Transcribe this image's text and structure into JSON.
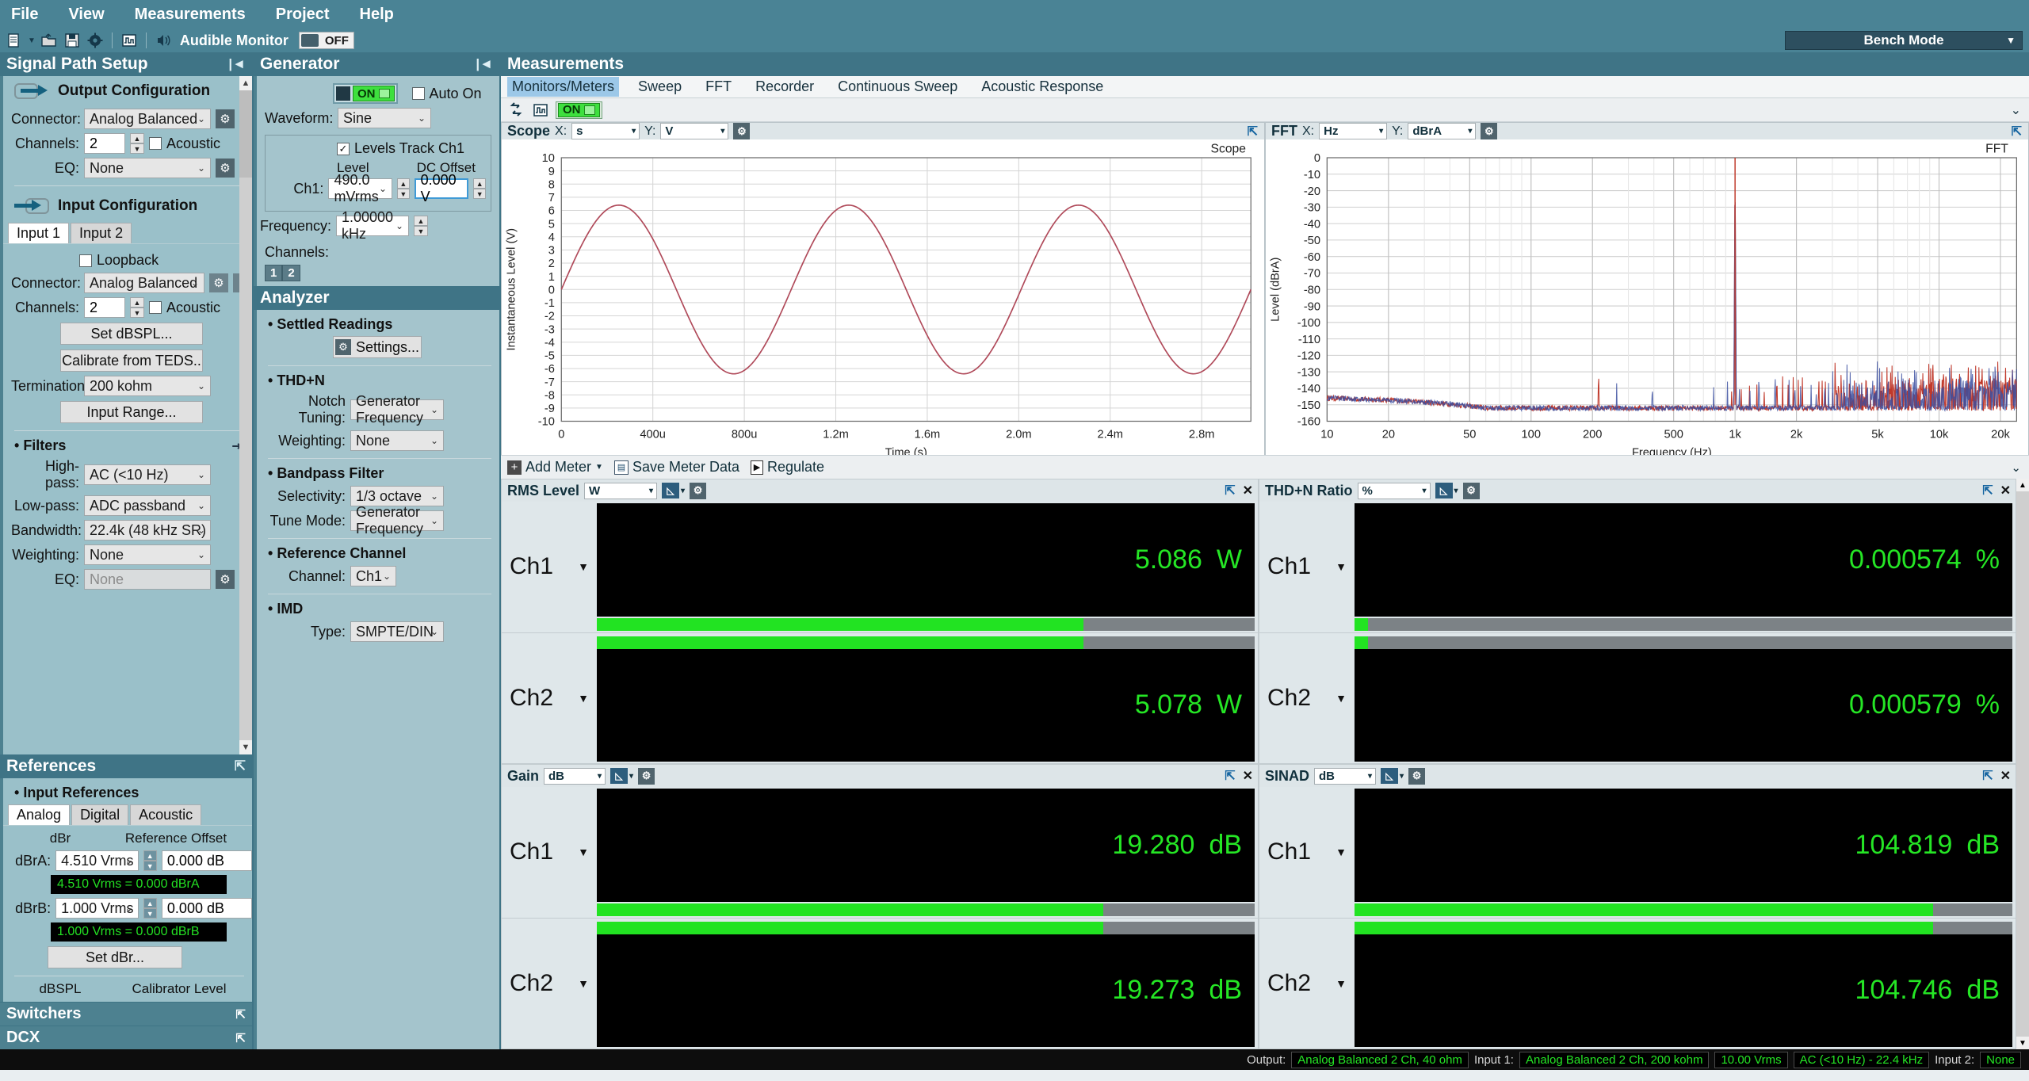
{
  "menu": {
    "items": [
      "File",
      "View",
      "Measurements",
      "Project",
      "Help"
    ]
  },
  "toolbar": {
    "icons": [
      "new-document-icon",
      "open-folder-icon",
      "save-icon",
      "gear-icon",
      "signal-icon",
      "speaker-icon"
    ],
    "audible_monitor_label": "Audible Monitor",
    "monitor_state": "OFF",
    "bench_mode_label": "Bench Mode"
  },
  "signal_path": {
    "title": "Signal Path Setup",
    "output": {
      "heading": "Output Configuration",
      "connector_label": "Connector:",
      "connector_value": "Analog Balanced",
      "channels_label": "Channels:",
      "channels_value": "2",
      "acoustic_label": "Acoustic",
      "eq_label": "EQ:",
      "eq_value": "None"
    },
    "input": {
      "heading": "Input Configuration",
      "tabs": [
        "Input 1",
        "Input 2"
      ],
      "active_tab": "Input 1",
      "loopback_label": "Loopback",
      "connector_label": "Connector:",
      "connector_value": "Analog Balanced",
      "channels_label": "Channels:",
      "channels_value": "2",
      "acoustic_label": "Acoustic",
      "set_dbspl_label": "Set dBSPL...",
      "calibrate_teds_label": "Calibrate from TEDS..",
      "termination_label": "Termination:",
      "termination_value": "200 kohm",
      "input_range_label": "Input Range..."
    },
    "filters": {
      "heading": "Filters",
      "highpass_label": "High-pass:",
      "highpass_value": "AC (<10 Hz)",
      "lowpass_label": "Low-pass:",
      "lowpass_value": "ADC passband",
      "bandwidth_label": "Bandwidth:",
      "bandwidth_value": "22.4k (48 kHz SR)",
      "weighting_label": "Weighting:",
      "weighting_value": "None",
      "eq_label": "EQ:",
      "eq_value": "None"
    }
  },
  "references": {
    "title": "References",
    "heading": "Input References",
    "tabs": [
      "Analog",
      "Digital",
      "Acoustic"
    ],
    "active_tab": "Analog",
    "col_dbr": "dBr",
    "col_reference_offset": "Reference Offset",
    "dbra_label": "dBrA:",
    "dbra_value": "4.510 Vrms",
    "dbra_offset": "0.000 dB",
    "dbra_readout": "4.510 Vrms = 0.000 dBrA",
    "dbrb_label": "dBrB:",
    "dbrb_value": "1.000 Vrms",
    "dbrb_offset": "0.000 dB",
    "dbrb_readout": "1.000 Vrms = 0.000 dBrB",
    "set_dbr_label": "Set dBr...",
    "col_dbspl": "dBSPL",
    "col_calibrator_level": "Calibrator Level"
  },
  "switchers": {
    "title": "Switchers"
  },
  "dcx": {
    "title": "DCX"
  },
  "generator": {
    "title": "Generator",
    "on_label": "ON",
    "auto_on_label": "Auto On",
    "waveform_label": "Waveform:",
    "waveform_value": "Sine",
    "levels_track_label": "Levels Track Ch1",
    "level_col": "Level",
    "dc_offset_col": "DC Offset",
    "ch1_label": "Ch1:",
    "ch1_level": "490.0 mVrms",
    "ch1_dc_offset": "0.000 V",
    "frequency_label": "Frequency:",
    "frequency_value": "1.00000 kHz",
    "channels_label": "Channels:",
    "channel_badges": [
      "1",
      "2"
    ]
  },
  "analyzer": {
    "title": "Analyzer",
    "settled_readings_heading": "Settled Readings",
    "settings_label": "Settings...",
    "thdn_heading": "THD+N",
    "notch_tuning_label": "Notch Tuning:",
    "notch_tuning_value": "Generator Frequency",
    "weighting_label": "Weighting:",
    "weighting_value": "None",
    "bandpass_heading": "Bandpass Filter",
    "selectivity_label": "Selectivity:",
    "selectivity_value": "1/3 octave",
    "tune_mode_label": "Tune Mode:",
    "tune_mode_value": "Generator Frequency",
    "reference_channel_heading": "Reference Channel",
    "channel_label": "Channel:",
    "channel_value": "Ch1",
    "imd_heading": "IMD",
    "type_label": "Type:",
    "type_value": "SMPTE/DIN"
  },
  "measurements": {
    "title": "Measurements",
    "tabs": [
      "Monitors/Meters",
      "Sweep",
      "FFT",
      "Recorder",
      "Continuous Sweep",
      "Acoustic Response"
    ],
    "active_tab": "Monitors/Meters",
    "toolbar_on_label": "ON",
    "toolbar_icons": [
      "swap-arrows-icon",
      "signal-icon"
    ]
  },
  "scope_panel": {
    "name": "Scope",
    "x_label": "X:",
    "x_unit": "s",
    "y_label": "Y:",
    "y_unit": "V"
  },
  "fft_panel": {
    "name": "FFT",
    "x_label": "X:",
    "x_unit": "Hz",
    "y_label": "Y:",
    "y_unit": "dBrA"
  },
  "meters_toolbar": {
    "add_meter_label": "Add Meter",
    "save_meter_data_label": "Save Meter Data",
    "regulate_label": "Regulate"
  },
  "meters": [
    {
      "name": "RMS Level",
      "unit": "W",
      "rows": [
        {
          "channel": "Ch1",
          "value": "5.086",
          "unit": "W",
          "bar_pct": 74
        },
        {
          "channel": "Ch2",
          "value": "5.078",
          "unit": "W",
          "bar_pct": 74
        }
      ]
    },
    {
      "name": "THD+N Ratio",
      "unit": "%",
      "rows": [
        {
          "channel": "Ch1",
          "value": "0.000574",
          "unit": "%",
          "bar_pct": 2
        },
        {
          "channel": "Ch2",
          "value": "0.000579",
          "unit": "%",
          "bar_pct": 2
        }
      ]
    },
    {
      "name": "Gain",
      "unit": "dB",
      "rows": [
        {
          "channel": "Ch1",
          "value": "19.280",
          "unit": "dB",
          "bar_pct": 77
        },
        {
          "channel": "Ch2",
          "value": "19.273",
          "unit": "dB",
          "bar_pct": 77
        }
      ]
    },
    {
      "name": "SINAD",
      "unit": "dB",
      "rows": [
        {
          "channel": "Ch1",
          "value": "104.819",
          "unit": "dB",
          "bar_pct": 88
        },
        {
          "channel": "Ch2",
          "value": "104.746",
          "unit": "dB",
          "bar_pct": 88
        }
      ]
    }
  ],
  "status_bar": {
    "output_label": "Output:",
    "output_value": "Analog Balanced 2 Ch, 40 ohm",
    "input1_label": "Input 1:",
    "input1_value": "Analog Balanced 2 Ch, 200 kohm",
    "input1_range": "10.00 Vrms",
    "input1_filter": "AC (<10 Hz) - 22.4 kHz",
    "input2_label": "Input 2:",
    "input2_value": "None"
  },
  "chart_data": [
    {
      "type": "line",
      "id": "scope",
      "title": "Scope",
      "xlabel": "Time (s)",
      "ylabel": "Instantaneous Level (V)",
      "xlim": [
        0,
        0.003
      ],
      "ylim": [
        -10,
        10
      ],
      "xticks": [
        "0",
        "400u",
        "800u",
        "1.2m",
        "1.6m",
        "2.0m",
        "2.4m",
        "2.8m"
      ],
      "yticks": [
        "10",
        "9",
        "8",
        "7",
        "6",
        "5",
        "4",
        "3",
        "2",
        "1",
        "0",
        "-1",
        "-2",
        "-3",
        "-4",
        "-5",
        "-6",
        "-7",
        "-8",
        "-9",
        "-10"
      ],
      "grid": true,
      "legend": "none",
      "series": [
        {
          "name": "Ch1",
          "color": "#b04a5a",
          "waveform": "sine",
          "amplitude": 6.4,
          "frequency_hz": 1000,
          "phase_deg": 0
        }
      ]
    },
    {
      "type": "line",
      "id": "fft",
      "title": "FFT",
      "xlabel": "Frequency (Hz)",
      "ylabel": "Level (dBrA)",
      "xscale": "log",
      "xlim": [
        10,
        24000
      ],
      "ylim": [
        -160,
        0
      ],
      "xticks": [
        "10",
        "20",
        "50",
        "100",
        "200",
        "500",
        "1k",
        "2k",
        "5k",
        "10k",
        "20k"
      ],
      "yticks": [
        "0",
        "-10",
        "-20",
        "-30",
        "-40",
        "-50",
        "-60",
        "-70",
        "-80",
        "-90",
        "-100",
        "-110",
        "-120",
        "-130",
        "-140",
        "-150",
        "-160"
      ],
      "grid": true,
      "legend": "none",
      "noise_floor_db": -152,
      "fundamental": {
        "frequency_hz": 1000,
        "level_db": 0
      },
      "series": [
        {
          "name": "Ch1",
          "color": "#c0392b"
        },
        {
          "name": "Ch2",
          "color": "#3b4fa0"
        }
      ]
    }
  ]
}
